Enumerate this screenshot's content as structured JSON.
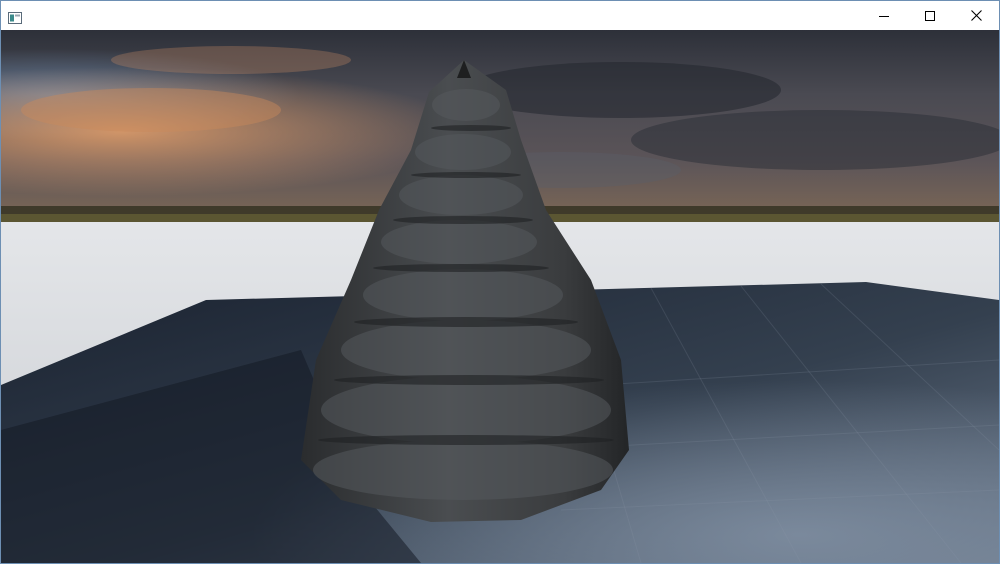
{
  "window": {
    "title": "",
    "controls": {
      "minimize": "minimize-icon",
      "maximize": "maximize-icon",
      "close": "close-icon"
    }
  },
  "viewport": {
    "scene": "3d-render",
    "colors": {
      "sky_top": "#2b2f3a",
      "sky_glow": "#d99662",
      "horizon_band": "#6a5a3a",
      "ground_plane": "#d6d8dc",
      "floor_plane": "#1b2432",
      "floor_lit": "#58677a",
      "rock": "#3a3d40"
    }
  }
}
